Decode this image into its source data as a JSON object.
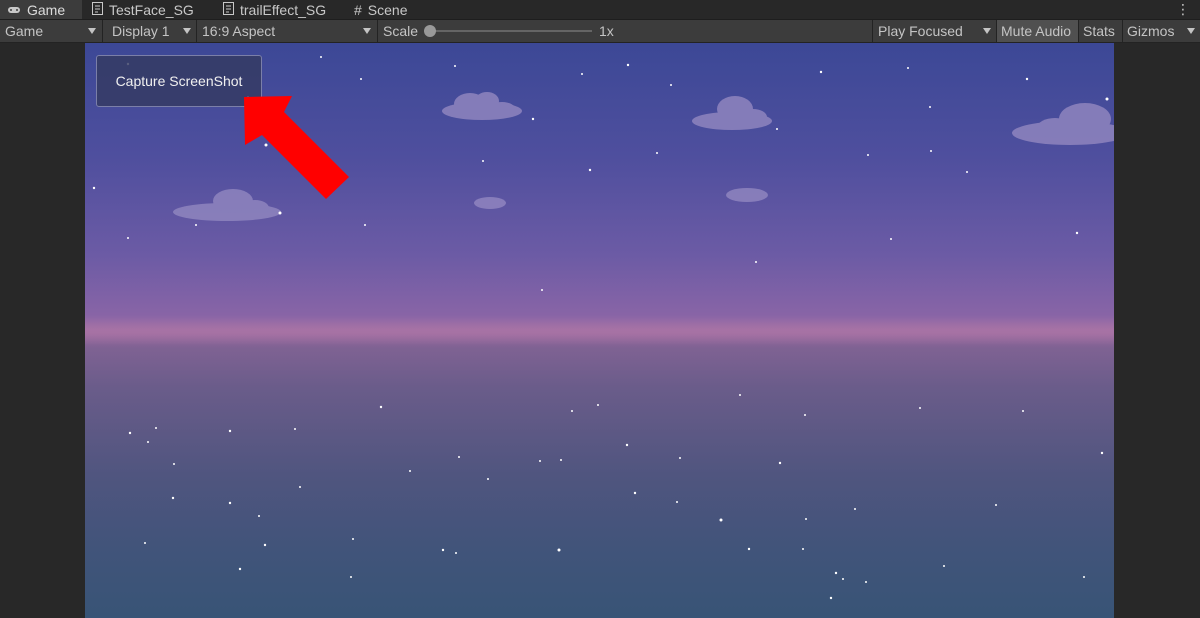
{
  "tabs": [
    {
      "label": "Game",
      "icon": "gamepad-icon",
      "active": true
    },
    {
      "label": "TestFace_SG",
      "icon": "shader-graph-icon",
      "active": false
    },
    {
      "label": "trailEffect_SG",
      "icon": "shader-graph-icon",
      "active": false
    },
    {
      "label": "Scene",
      "icon": "scene-grid-icon",
      "active": false
    }
  ],
  "toolbar": {
    "view_mode": "Game",
    "display": "Display 1",
    "aspect": "16:9 Aspect",
    "scale_label": "Scale",
    "scale_value": "1x",
    "play_mode": "Play Focused",
    "mute_audio": "Mute Audio",
    "stats": "Stats",
    "gizmos": "Gizmos"
  },
  "game": {
    "capture_button_label": "Capture ScreenShot"
  },
  "colors": {
    "editor_bg": "#282828",
    "toolbar_bg": "#3c3c3c",
    "arrow": "#ff0000",
    "sky_top": "#3c4896",
    "horizon": "#9b6ba0",
    "water_bottom": "#385476"
  }
}
